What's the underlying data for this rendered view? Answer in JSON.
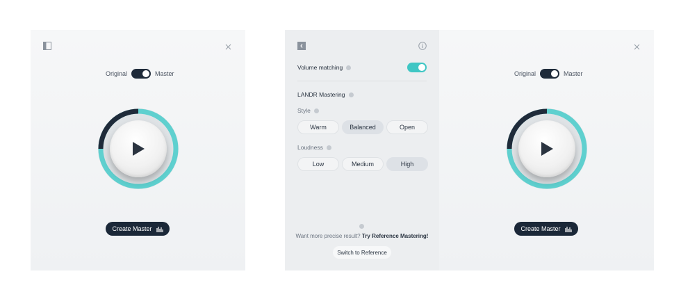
{
  "colors": {
    "accent": "#3fc6c4",
    "dark": "#1b2838",
    "panel_bg": "#f3f4f5"
  },
  "left_panel": {
    "toggle": {
      "left_label": "Original",
      "right_label": "Master",
      "state": "master"
    },
    "play_icon": "play-icon",
    "create_button": {
      "label": "Create Master",
      "icon": "bars-icon"
    }
  },
  "settings": {
    "volume_matching": {
      "label": "Volume matching",
      "enabled": true
    },
    "section_title": "LANDR Mastering",
    "style": {
      "label": "Style",
      "options": [
        "Warm",
        "Balanced",
        "Open"
      ],
      "selected": "Balanced"
    },
    "loudness": {
      "label": "Loudness",
      "options": [
        "Low",
        "Medium",
        "High"
      ],
      "selected": "High"
    },
    "reference": {
      "question": "Want more precise result?",
      "link": "Try Reference Mastering!",
      "button_label": "Switch to Reference"
    }
  },
  "right_panel": {
    "toggle": {
      "left_label": "Original",
      "right_label": "Master",
      "state": "master"
    },
    "create_button": {
      "label": "Create Master",
      "icon": "bars-icon"
    }
  }
}
